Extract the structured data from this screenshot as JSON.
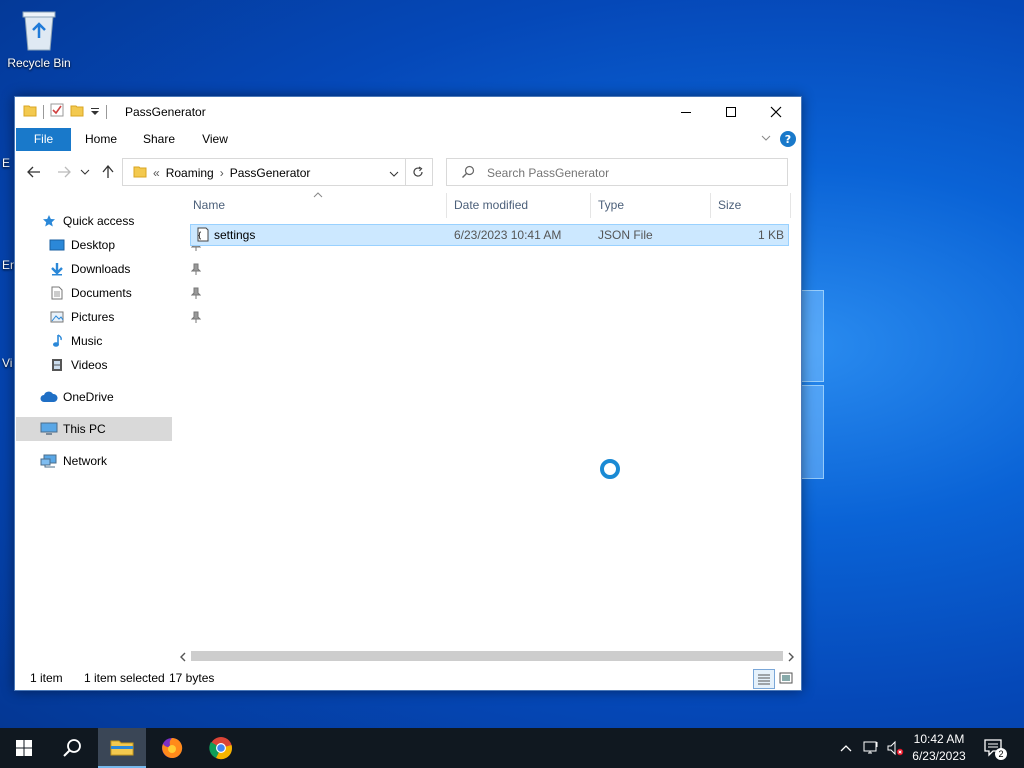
{
  "desktop": {
    "recycle_bin_label": "Recycle Bin",
    "edge_fragments": [
      "E",
      "En",
      "Vi"
    ]
  },
  "window": {
    "title": "PassGenerator",
    "ribbon_tabs": [
      "File",
      "Home",
      "Share",
      "View"
    ],
    "breadcrumb_prefix": "«",
    "breadcrumbs": [
      "Roaming",
      "PassGenerator"
    ],
    "search_placeholder": "Search PassGenerator",
    "columns": [
      "Name",
      "Date modified",
      "Type",
      "Size"
    ],
    "files": [
      {
        "name": "settings",
        "date_modified": "6/23/2023 10:41 AM",
        "type": "JSON File",
        "size": "1 KB"
      }
    ],
    "status": {
      "item_count": "1 item",
      "selection": "1 item selected",
      "bytes": "17 bytes"
    }
  },
  "nav_pane": {
    "quick_access": "Quick access",
    "quick_items": [
      "Desktop",
      "Downloads",
      "Documents",
      "Pictures",
      "Music",
      "Videos"
    ],
    "onedrive": "OneDrive",
    "this_pc": "This PC",
    "network": "Network"
  },
  "taskbar": {
    "time": "10:42 AM",
    "date": "6/23/2023",
    "notification_count": "2"
  },
  "colors": {
    "accent": "#1979ca",
    "selection": "#cce8ff",
    "taskbar": "#101820"
  }
}
